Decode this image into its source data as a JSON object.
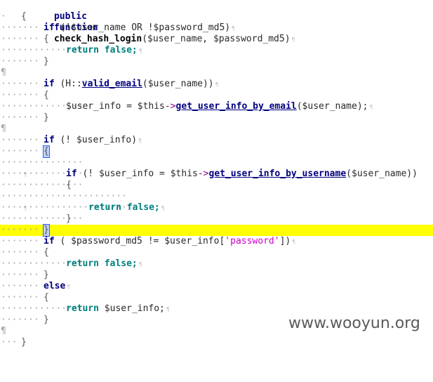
{
  "code": {
    "line_function": [
      "public",
      "function",
      "check_hash_login",
      "($user_name, $password_md5)"
    ],
    "brace_open": "{",
    "brace_close": "}",
    "line_if1": [
      "if",
      " (!$user_name OR !$password_md5)"
    ],
    "ret_false": [
      "return",
      " false;"
    ],
    "line_if2": [
      "if",
      " (H::",
      "valid_email",
      "($user_name))"
    ],
    "line_assign1": [
      "$user_info = $this",
      "->",
      "get_user_info_by_email",
      "($user_name);"
    ],
    "line_if3": [
      "if",
      " (! $user_info)"
    ],
    "line_if4": [
      "if",
      " (! $user_info = $this",
      "->",
      "get_user_info_by_username",
      "($user_name))"
    ],
    "line_if5": [
      "if",
      " ( $password_md5 != $user_info[",
      "'password'",
      "])"
    ],
    "line_else": "else",
    "ret_user": [
      "return",
      " $user_info;"
    ]
  },
  "watermark": "www.wooyun.org"
}
